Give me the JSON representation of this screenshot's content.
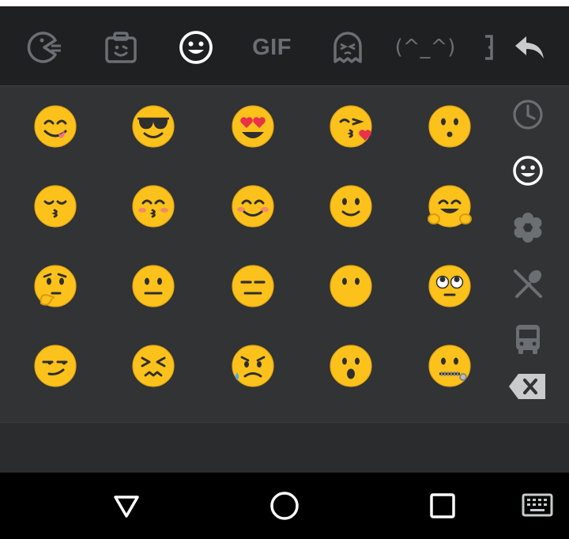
{
  "toolbar": {
    "tabs": [
      {
        "name": "pacman-sticker-icon",
        "active": false
      },
      {
        "name": "selfie-sticker-icon",
        "active": false
      },
      {
        "name": "smiley-icon",
        "active": true
      },
      {
        "name": "gif-tab",
        "label": "GIF",
        "active": false
      },
      {
        "name": "ghost-sticker-icon",
        "active": false
      },
      {
        "name": "kaomoji-tab",
        "label": "(^_^)",
        "active": false
      }
    ],
    "back_icon": "reply-arrow-icon"
  },
  "emoji_grid": {
    "rows": [
      [
        "😋",
        "😎",
        "😍",
        "😘",
        "😗"
      ],
      [
        "😙",
        "😚",
        "☺️",
        "🙂",
        "🤗"
      ],
      [
        "🤔",
        "😐",
        "😑",
        "😶",
        "🙄"
      ],
      [
        "😏",
        "😣",
        "😥",
        "😮",
        "🤐"
      ]
    ]
  },
  "categories": [
    {
      "name": "recent-clock-icon",
      "active": false
    },
    {
      "name": "smileys-icon",
      "active": true
    },
    {
      "name": "nature-flower-icon",
      "active": false
    },
    {
      "name": "food-utensils-icon",
      "active": false
    },
    {
      "name": "travel-bus-icon",
      "active": false
    },
    {
      "name": "backspace-icon",
      "active": false
    }
  ],
  "navbar": {
    "buttons": [
      "back-triangle-icon",
      "home-circle-icon",
      "recents-square-icon",
      "keyboard-icon"
    ]
  },
  "colors": {
    "toolbar_bg": "#1f2022",
    "panel_bg": "#313335",
    "inactive_icon": "#6b6e72",
    "active_icon": "#ffffff",
    "emoji_yellow": "#fcc21b",
    "navbar_bg": "#000000"
  }
}
